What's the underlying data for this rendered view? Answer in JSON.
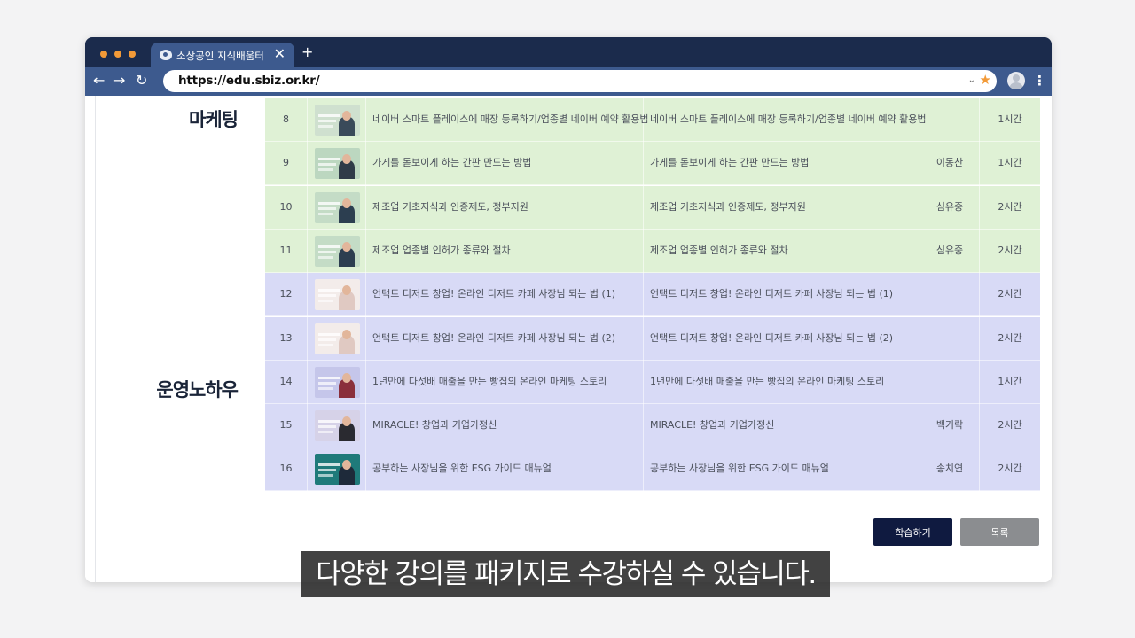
{
  "browser": {
    "tab_title": "소상공인 지식배움터",
    "tab_close": "✕",
    "new_tab": "+",
    "nav": {
      "back": "←",
      "forward": "→",
      "reload": "↻"
    },
    "url": "https://edu.sbiz.or.kr/",
    "url_chevron": "⌄",
    "bookmark_star": "★",
    "menu": "⋮"
  },
  "categories": {
    "marketing": "마케팅",
    "operation_knowhow": "운영노하우"
  },
  "courses": [
    {
      "no": "8",
      "title": "네이버 스마트 플레이스에 매장 등록하기/업종별 네이버 예약 활용법",
      "subtitle": "네이버 스마트 플레이스에 매장 등록하기/업종별 네이버 예약 활용법",
      "instructor": "",
      "time": "1시간",
      "group": "green"
    },
    {
      "no": "9",
      "title": "가게를 돋보이게 하는 간판 만드는 방법",
      "subtitle": "가게를 돋보이게 하는 간판 만드는 방법",
      "instructor": "이동찬",
      "time": "1시간",
      "group": "green"
    },
    {
      "no": "10",
      "title": "제조업 기초지식과 인증제도, 정부지원",
      "subtitle": "제조업 기초지식과 인증제도, 정부지원",
      "instructor": "심유중",
      "time": "2시간",
      "group": "green"
    },
    {
      "no": "11",
      "title": "제조업 업종별 인허가 종류와 절차",
      "subtitle": "제조업 업종별 인허가 종류와 절차",
      "instructor": "심유중",
      "time": "2시간",
      "group": "green"
    },
    {
      "no": "12",
      "title": "언택트 디저트 창업! 온라인 디저트 카페 사장님 되는 법 (1)",
      "subtitle": "언택트 디저트 창업! 온라인 디저트 카페 사장님 되는 법 (1)",
      "instructor": "",
      "time": "2시간",
      "group": "purple"
    },
    {
      "no": "13",
      "title": "언택트 디저트 창업! 온라인 디저트 카페 사장님 되는 법 (2)",
      "subtitle": "언택트 디저트 창업! 온라인 디저트 카페 사장님 되는 법 (2)",
      "instructor": "",
      "time": "2시간",
      "group": "purple"
    },
    {
      "no": "14",
      "title": "1년만에 다섯배 매출을 만든 빵집의 온라인 마케팅 스토리",
      "subtitle": "1년만에 다섯배 매출을 만든 빵집의 온라인 마케팅 스토리",
      "instructor": "",
      "time": "1시간",
      "group": "purple"
    },
    {
      "no": "15",
      "title": "MIRACLE! 창업과 기업가정신",
      "subtitle": "MIRACLE! 창업과 기업가정신",
      "instructor": "백기락",
      "time": "2시간",
      "group": "purple"
    },
    {
      "no": "16",
      "title": "공부하는 사장님을 위한 ESG 가이드 매뉴얼",
      "subtitle": "공부하는 사장님을 위한 ESG 가이드 매뉴얼",
      "instructor": "송치연",
      "time": "2시간",
      "group": "purple"
    }
  ],
  "buttons": {
    "study": "학습하기",
    "list": "목록"
  },
  "caption": "다양한 강의를 패키지로 수강하실 수 있습니다.",
  "colors": {
    "tab_bar": "#1b2b4c",
    "toolbar": "#3d5a8e",
    "marketing_rows": "#dff1d5",
    "operation_rows": "#d8daf6",
    "study_button": "#0f1a40",
    "list_button": "#8b8d90",
    "accent_orange": "#f29a38"
  }
}
